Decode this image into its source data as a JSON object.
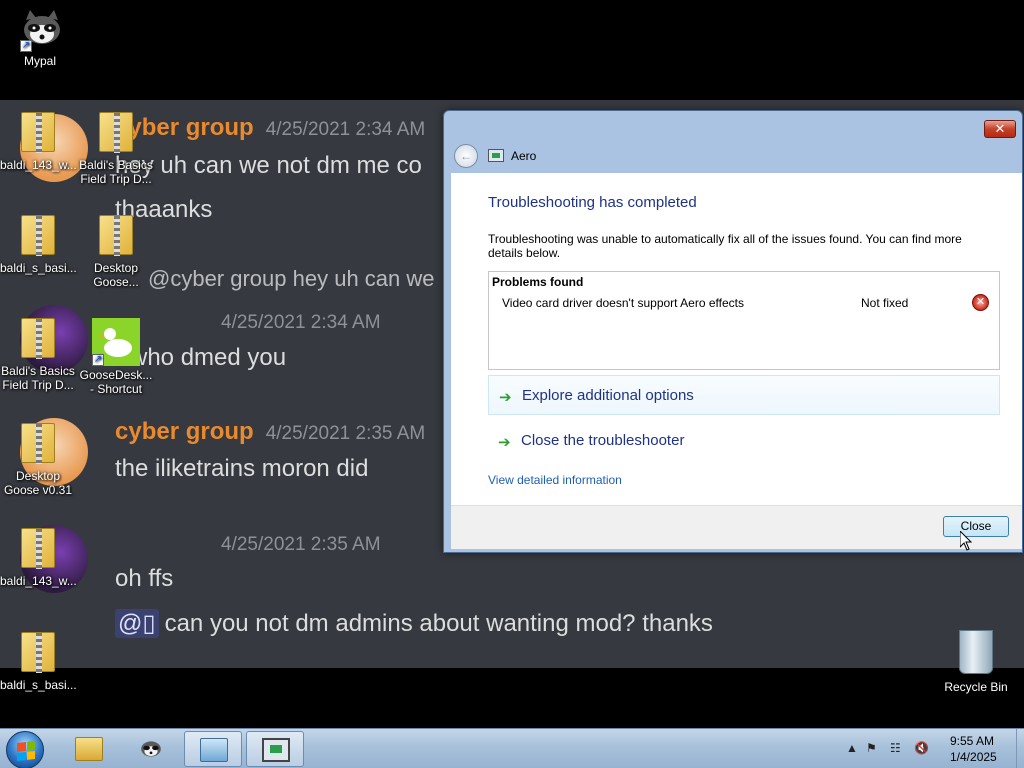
{
  "desktop": {
    "top_icon_label": "Mypal",
    "icons": [
      {
        "label": "baldi_143_w..."
      },
      {
        "label": "Baldi's Basics Field Trip D..."
      },
      {
        "label": "baldi_s_basi..."
      },
      {
        "label": "Desktop Goose..."
      },
      {
        "label": "Baldi's Basics Field Trip D..."
      },
      {
        "label": "GooseDesk... - Shortcut"
      },
      {
        "label": "Desktop Goose v0.31"
      },
      {
        "label": "baldi_143_w..."
      },
      {
        "label": "baldi_s_basi..."
      }
    ],
    "recycle_bin_label": "Recycle Bin"
  },
  "wallpaper_chat": {
    "messages": [
      {
        "name": "cyber group",
        "time": "4/25/2021 2:34 AM",
        "lines": [
          "hey uh can we not dm me co",
          "thaaanks"
        ]
      },
      {
        "reply_preview": "@cyber group hey uh can we",
        "name": "",
        "time": "4/25/2021 2:34 AM",
        "lines": [
          "who dmed you"
        ]
      },
      {
        "name": "cyber group",
        "time": "4/25/2021 2:35 AM",
        "lines": [
          "the iliketrains moron did"
        ]
      },
      {
        "name": "",
        "time": "4/25/2021 2:35 AM",
        "lines": [
          "oh ffs"
        ]
      }
    ],
    "mention_chip": "@▯",
    "last_line": "can you not dm admins about wanting mod? thanks"
  },
  "troubleshooter": {
    "close_x": "✕",
    "title": "Aero",
    "heading": "Troubleshooting has completed",
    "description": "Troubleshooting was unable to automatically fix all of the issues found. You can find more details below.",
    "problems_title": "Problems found",
    "problem_name": "Video card driver doesn't support Aero effects",
    "problem_status": "Not fixed",
    "options": [
      "Explore additional options",
      "Close the troubleshooter"
    ],
    "view_details": "View detailed information",
    "close_button": "Close",
    "accent_heading": "#1e3287",
    "error_color": "#d43a2b"
  },
  "taskbar": {
    "clock_time": "9:55 AM",
    "clock_date": "1/4/2025",
    "pinned": [
      "start-orb",
      "explorer-icon",
      "mypal-icon",
      "control-panel-icon",
      "troubleshooter-icon"
    ],
    "tray_icons": [
      "show-hidden-icons",
      "action-center-flag-icon",
      "network-icon",
      "volume-muted-icon"
    ]
  }
}
